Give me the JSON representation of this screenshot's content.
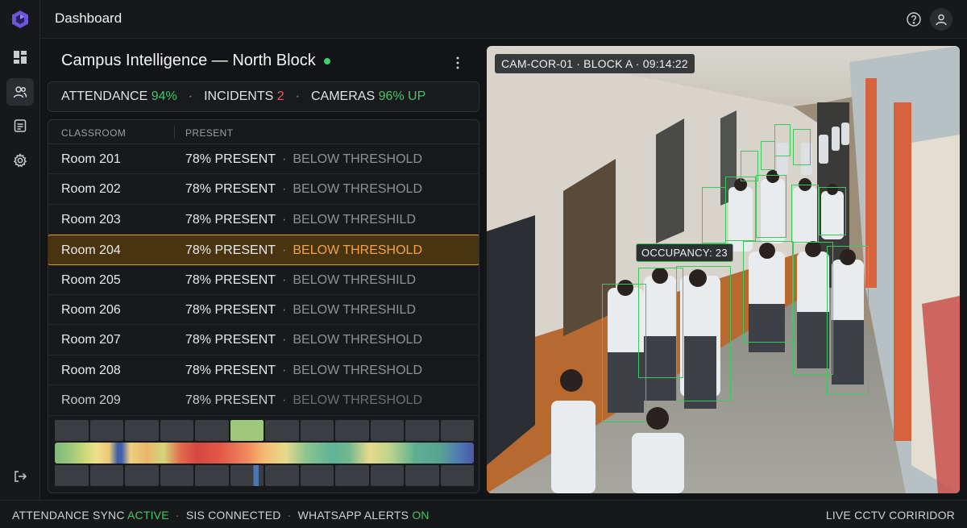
{
  "header": {
    "title": "Dashboard"
  },
  "panel": {
    "title": "Campus Intelligence — North Block"
  },
  "stats": {
    "attendance_label": "ATTENDANCE",
    "attendance_value": "94%",
    "incidents_label": "INCIDENTS",
    "incidents_value": "2",
    "cameras_label": "CAMERAS",
    "cameras_value": "96% UP",
    "separator": "·"
  },
  "table": {
    "columns": [
      "CLASSROOM",
      "PRESENT"
    ],
    "rows": [
      {
        "room": "Room 201",
        "present": "78% PRESENT",
        "status": "BELOW THRESHOLD"
      },
      {
        "room": "Room 202",
        "present": "78% PRESENT",
        "status": "BELOW THRESHOLD"
      },
      {
        "room": "Room 203",
        "present": "78% PRESENT",
        "status": "BELOW THRESHILD"
      },
      {
        "room": "Room 204",
        "present": "78% PRESENT",
        "status": "BELOW THRESHOLD"
      },
      {
        "room": "Room 205",
        "present": "78% PRESENT",
        "status": "BELOW THRESHILD"
      },
      {
        "room": "Room 206",
        "present": "78% PRESENT",
        "status": "BELOW THRESHILD"
      },
      {
        "room": "Room 207",
        "present": "78% PRESENT",
        "status": "BELOW THRESHOLD"
      },
      {
        "room": "Room 208",
        "present": "78% PRESENT",
        "status": "BELOW THRESHOLD"
      },
      {
        "room": "Room 209",
        "present": "78% PRESENT",
        "status": "BELOW THRESHOLD"
      }
    ],
    "bullet": "·"
  },
  "camera": {
    "label": "CAM-COR-01 · BLOCK A · 09:14:22",
    "occupancy": "OCCUPANCY: 23"
  },
  "statusbar": {
    "sync_label": "ATTENDANCE SYNC",
    "sync_value": "ACTIVE",
    "sis": "SIS CONNECTED",
    "wa_label": "WHATSAPP ALERTS",
    "wa_value": "ON",
    "right": "LIVE CCTV CORIRIDOR",
    "separator": "·"
  },
  "colors": {
    "accent_green": "#45c46a",
    "alert_red": "#ec5b5b",
    "highlight_amber": "#f2a24a"
  },
  "icons": [
    "logo-icon",
    "dashboard-icon",
    "users-icon",
    "document-icon",
    "gear-icon",
    "logout-icon",
    "help-icon",
    "user-icon",
    "kebab-icon"
  ]
}
